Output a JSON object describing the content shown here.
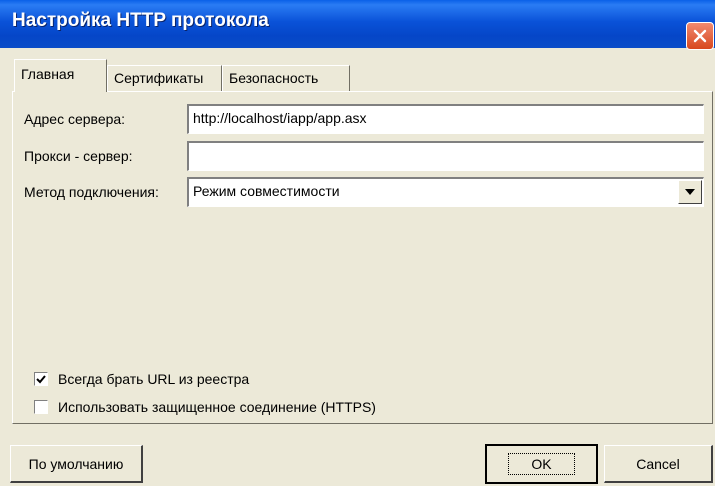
{
  "window": {
    "title": "Настройка HTTP протокола"
  },
  "tabs": [
    {
      "label": "Главная",
      "active": true
    },
    {
      "label": "Сертификаты",
      "active": false
    },
    {
      "label": "Безопасность",
      "active": false
    }
  ],
  "form": {
    "server_address_label": "Адрес сервера:",
    "server_address_value": "http://localhost/iapp/app.asx",
    "proxy_label": "Прокси - сервер:",
    "proxy_value": "",
    "method_label": "Метод подключения:",
    "method_value": "Режим совместимости"
  },
  "options": {
    "always_url_label": "Всегда брать URL из реестра",
    "always_url_checked": true,
    "https_label": "Использовать защищенное соединение (HTTPS)",
    "https_checked": false
  },
  "buttons": {
    "default_label": "По умолчанию",
    "ok_label": "OK",
    "cancel_label": "Cancel"
  },
  "icons": {
    "close": "close-icon",
    "dropdown": "chevron-down-icon",
    "check": "checkmark-icon"
  },
  "colors": {
    "titlebar": "#0A52D8",
    "dialog_bg": "#ECE9D8",
    "close_button": "#D8471E"
  }
}
